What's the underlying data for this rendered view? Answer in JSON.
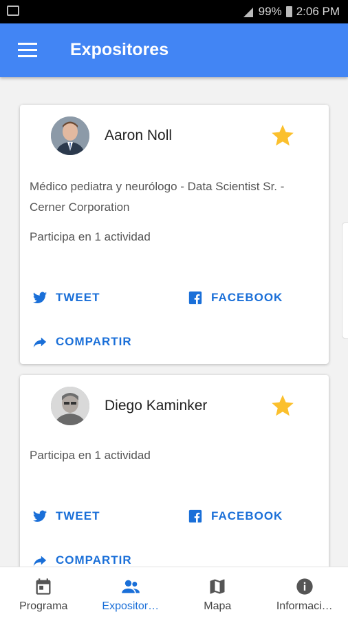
{
  "status_bar": {
    "battery": "99%",
    "time": "2:06 PM"
  },
  "app_bar": {
    "title": "Expositores"
  },
  "speakers": [
    {
      "name": "Aaron Noll",
      "description": "Médico pediatra y neurólogo - Data Scientist Sr. - Cerner Corporation",
      "activity": "Participa en 1 actividad",
      "favorite": true
    },
    {
      "name": "Diego Kaminker",
      "activity": "Participa en 1 actividad",
      "favorite": true
    }
  ],
  "actions": {
    "tweet": "TWEET",
    "facebook": "FACEBOOK",
    "share": "COMPARTIR"
  },
  "bottom_nav": [
    {
      "label": "Programa",
      "icon": "calendar-icon"
    },
    {
      "label": "Expositor…",
      "icon": "people-icon",
      "active": true
    },
    {
      "label": "Mapa",
      "icon": "map-icon"
    },
    {
      "label": "Informaci…",
      "icon": "info-icon"
    }
  ],
  "colors": {
    "primary": "#4285f4",
    "accent_text": "#1a6fd8",
    "star": "#fbc02d"
  }
}
